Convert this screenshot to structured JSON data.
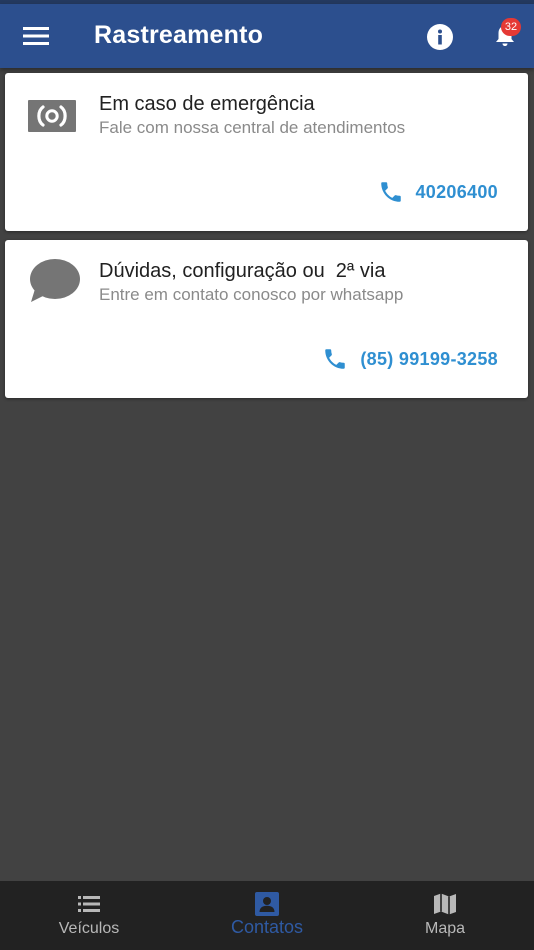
{
  "appbar": {
    "title": "Rastreamento",
    "notification_count": "32"
  },
  "icons": {
    "menu": "hamburger-menu-icon",
    "info": "info-circle-icon",
    "bell": "bell-icon",
    "emergency": "broadcast-signal-icon",
    "chat": "chat-bubble-icon",
    "phone": "phone-icon",
    "vehicles": "list-icon",
    "contacts": "contact-card-icon",
    "map": "map-icon"
  },
  "cards": [
    {
      "title": "Em caso de emergência",
      "subtitle": "Fale com nossa central de atendimentos",
      "phone": "40206400"
    },
    {
      "title": "Dúvidas, configuração ou  2ª via",
      "subtitle": "Entre em contato conosco por whatsapp",
      "phone": "(85) 99199-3258"
    }
  ],
  "bottom_nav": {
    "items": [
      {
        "label": "Veículos",
        "active": false
      },
      {
        "label": "Contatos",
        "active": true
      },
      {
        "label": "Mapa",
        "active": false
      }
    ]
  },
  "colors": {
    "appbar": "#2c4f8e",
    "background": "#424242",
    "link": "#2f8fd1",
    "active_tab": "#2f5aa3",
    "badge": "#e53935",
    "bottom_nav": "#222222"
  }
}
